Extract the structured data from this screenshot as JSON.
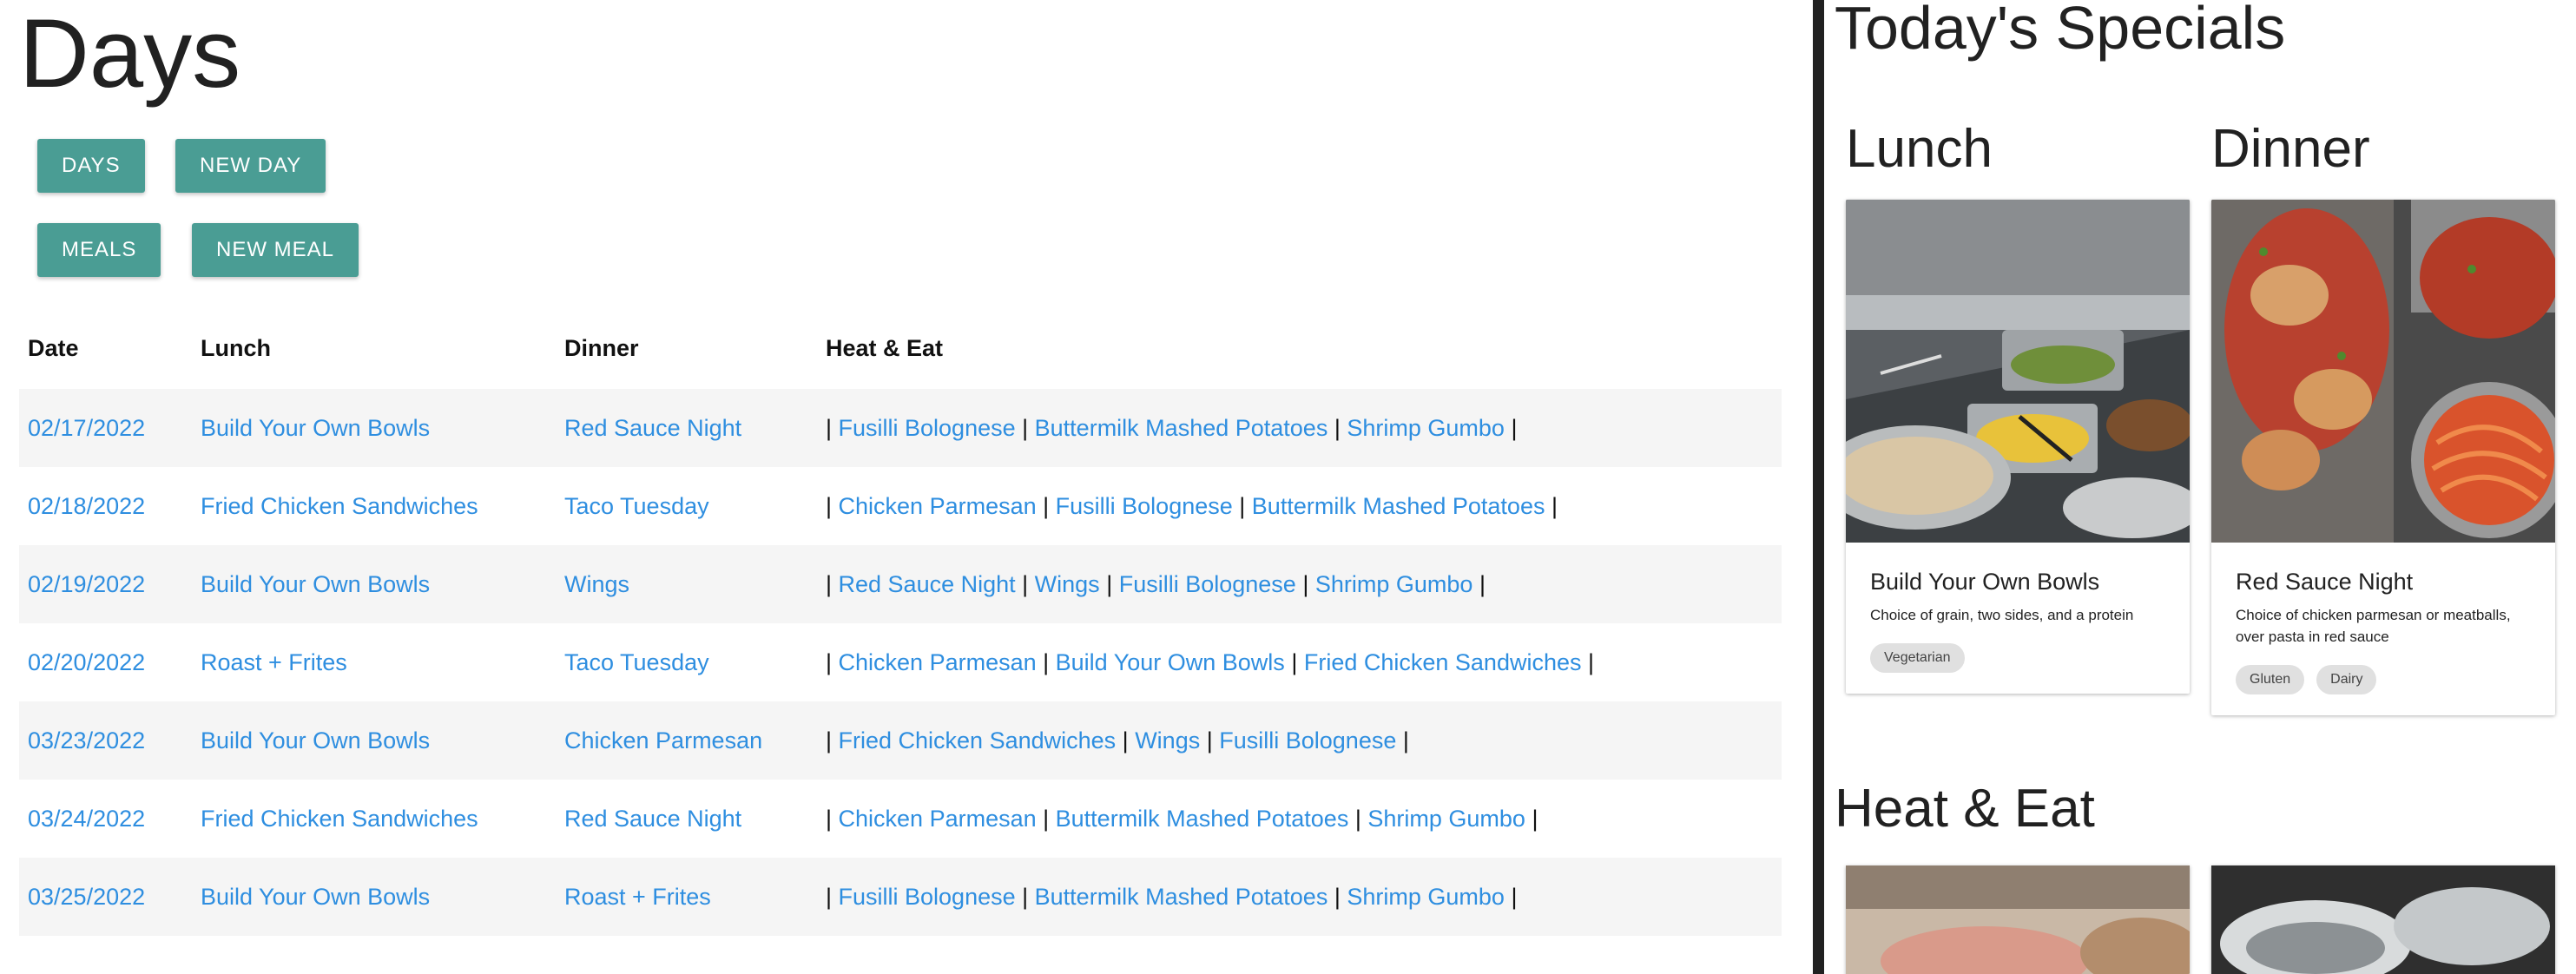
{
  "page": {
    "title": "Days"
  },
  "buttons": {
    "days": "DAYS",
    "new_day": "NEW DAY",
    "meals": "MEALS",
    "new_meal": "NEW MEAL"
  },
  "table": {
    "headers": {
      "date": "Date",
      "lunch": "Lunch",
      "dinner": "Dinner",
      "heat": "Heat & Eat"
    },
    "rows": [
      {
        "date": "02/17/2022",
        "lunch": "Build Your Own Bowls",
        "dinner": "Red Sauce Night",
        "heat": [
          "Fusilli Bolognese",
          "Buttermilk Mashed Potatoes",
          "Shrimp Gumbo"
        ]
      },
      {
        "date": "02/18/2022",
        "lunch": "Fried Chicken Sandwiches",
        "dinner": "Taco Tuesday",
        "heat": [
          "Chicken Parmesan",
          "Fusilli Bolognese",
          "Buttermilk Mashed Potatoes"
        ]
      },
      {
        "date": "02/19/2022",
        "lunch": "Build Your Own Bowls",
        "dinner": "Wings",
        "heat": [
          "Red Sauce Night",
          "Wings",
          "Fusilli Bolognese",
          "Shrimp Gumbo"
        ]
      },
      {
        "date": "02/20/2022",
        "lunch": "Roast + Frites",
        "dinner": "Taco Tuesday",
        "heat": [
          "Chicken Parmesan",
          "Build Your Own Bowls",
          "Fried Chicken Sandwiches"
        ]
      },
      {
        "date": "03/23/2022",
        "lunch": "Build Your Own Bowls",
        "dinner": "Chicken Parmesan",
        "heat": [
          "Fried Chicken Sandwiches",
          "Wings",
          "Fusilli Bolognese"
        ]
      },
      {
        "date": "03/24/2022",
        "lunch": "Fried Chicken Sandwiches",
        "dinner": "Red Sauce Night",
        "heat": [
          "Chicken Parmesan",
          "Buttermilk Mashed Potatoes",
          "Shrimp Gumbo"
        ]
      },
      {
        "date": "03/25/2022",
        "lunch": "Build Your Own Bowls",
        "dinner": "Roast + Frites",
        "heat": [
          "Fusilli Bolognese",
          "Buttermilk Mashed Potatoes",
          "Shrimp Gumbo"
        ]
      }
    ]
  },
  "specials": {
    "title": "Today's Specials",
    "lunch": {
      "heading": "Lunch",
      "name": "Build Your Own Bowls",
      "description": "Choice of grain, two sides, and a protein",
      "tags": [
        "Vegetarian"
      ]
    },
    "dinner": {
      "heading": "Dinner",
      "name": "Red Sauce Night",
      "description": "Choice of chicken parmesan or meatballs, over pasta in red sauce",
      "tags": [
        "Gluten",
        "Dairy"
      ]
    },
    "heat_title": "Heat & Eat"
  },
  "colors": {
    "accent": "#4a9d94",
    "link": "#2e8ee0",
    "divider": "#212121"
  }
}
